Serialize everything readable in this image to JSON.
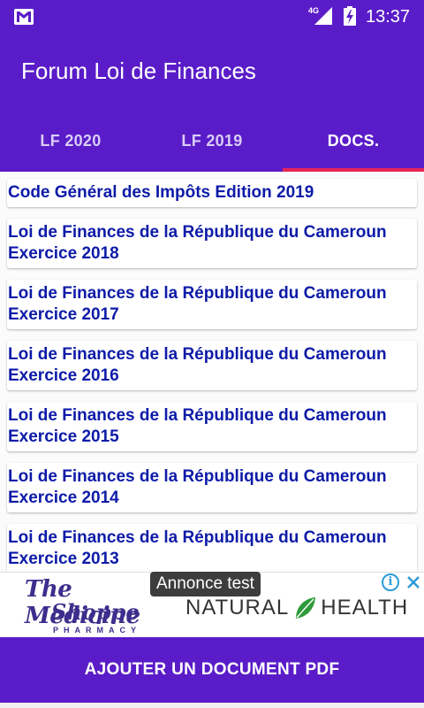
{
  "status_bar": {
    "network": "4G",
    "time": "13:37",
    "icons": [
      "gmail-icon",
      "signal-icon",
      "battery-charging-icon"
    ]
  },
  "app_bar": {
    "title": "Forum Loi de Finances"
  },
  "tabs": [
    {
      "label": "LF 2020",
      "active": false
    },
    {
      "label": "LF 2019",
      "active": false
    },
    {
      "label": "DOCS.",
      "active": true
    }
  ],
  "documents": [
    {
      "title": "Code Général des Impôts Edition 2019"
    },
    {
      "title": "Loi de Finances de la République du Cameroun Exercice 2018"
    },
    {
      "title": "Loi de Finances de la République du Cameroun Exercice 2017"
    },
    {
      "title": "Loi de Finances de la République du Cameroun Exercice 2016"
    },
    {
      "title": "Loi de Finances de la République du Cameroun Exercice 2015"
    },
    {
      "title": "Loi de Finances de la République du Cameroun Exercice 2014"
    },
    {
      "title": "Loi de Finances de la République du Cameroun Exercice 2013"
    }
  ],
  "ad": {
    "label": "Annonce test",
    "brand1_line1": "The Medicine",
    "brand1_line2": "Shoppe",
    "brand1_line3": "PHARMACY",
    "brand2_left": "NATURAL",
    "brand2_right": "HEALTH",
    "info_icon": "i",
    "icons": [
      "info-icon",
      "close-icon",
      "leaf-icon"
    ]
  },
  "bottom_button": {
    "label": "AJOUTER UN DOCUMENT PDF"
  },
  "colors": {
    "primary": "#5a1cc8",
    "accent": "#e8245a",
    "item_text": "#0d1ba8"
  }
}
